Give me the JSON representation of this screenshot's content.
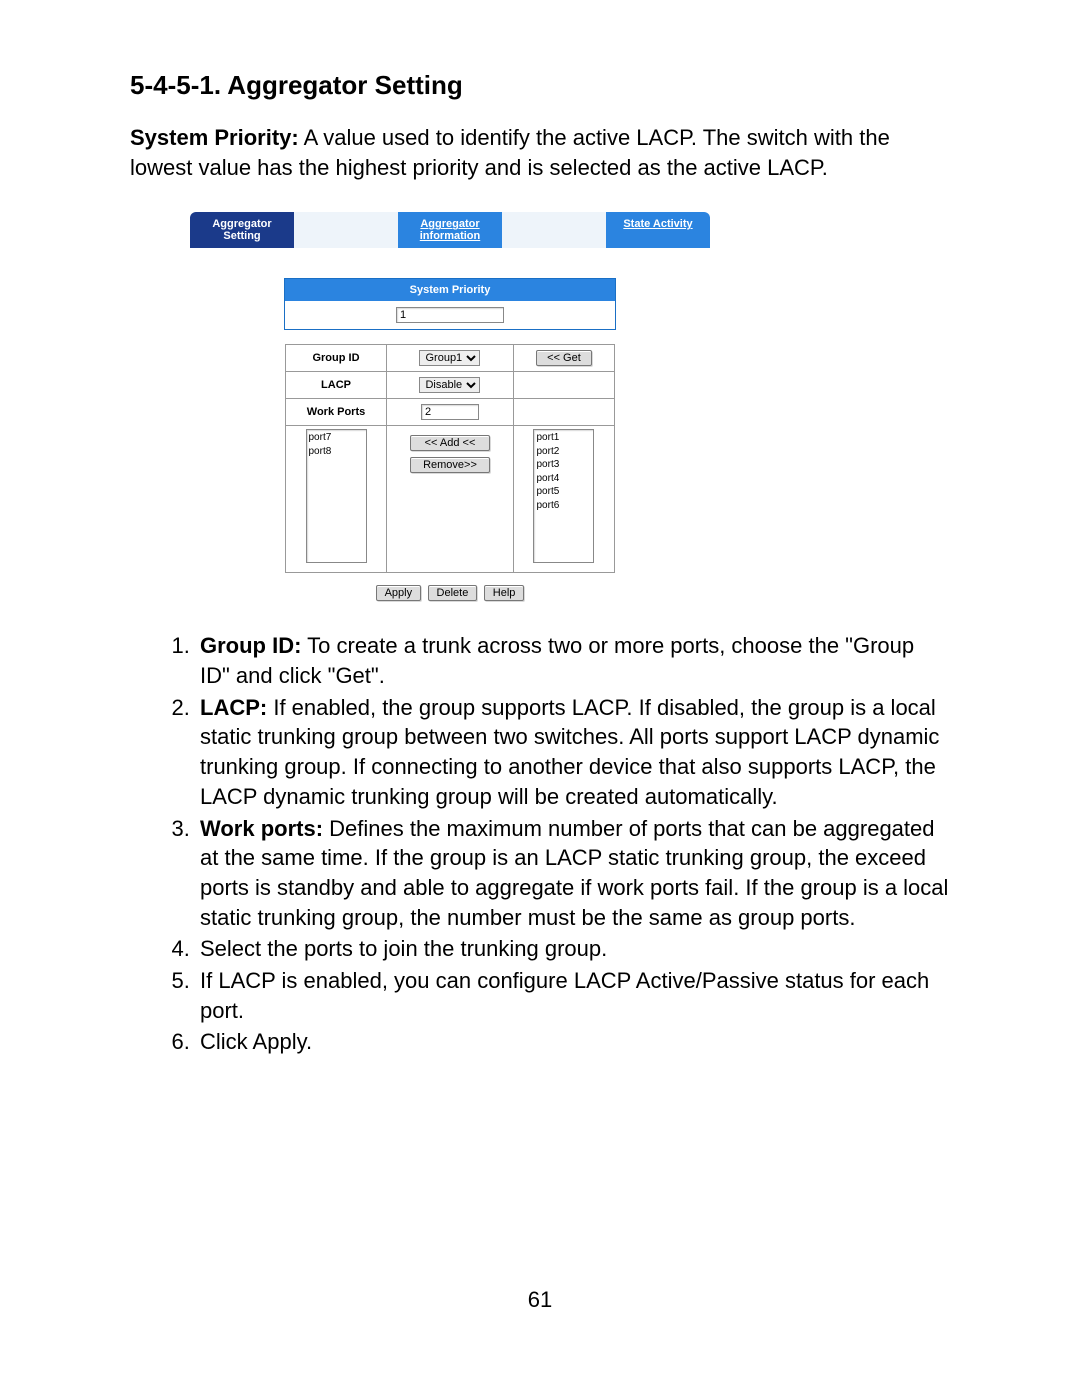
{
  "heading": "5-4-5-1. Aggregator Setting",
  "intro_label": "System Priority:",
  "intro_text": " A value used to identify the active LACP. The switch with the lowest value has the highest priority and is selected as the active LACP.",
  "tabs": {
    "t0": "Aggregator Setting",
    "t1": "Aggregator information",
    "t2": "State Activity"
  },
  "panel": {
    "sys_priority_label": "System Priority",
    "sys_priority_value": "1",
    "row_group_label": "Group ID",
    "row_group_value": "Group1",
    "row_group_btn": "<< Get",
    "row_lacp_label": "LACP",
    "row_lacp_value": "Disable",
    "row_wp_label": "Work Ports",
    "row_wp_value": "2",
    "left_ports": [
      "port7",
      "port8"
    ],
    "right_ports": [
      "port1",
      "port2",
      "port3",
      "port4",
      "port5",
      "port6"
    ],
    "btn_add": "<< Add <<",
    "btn_remove": "Remove>>",
    "btn_apply": "Apply",
    "btn_delete": "Delete",
    "btn_help": "Help"
  },
  "list": {
    "i1_label": "Group ID:",
    "i1_text": " To create a trunk across two or more ports, choose the \"Group ID\" and click \"Get\".",
    "i2_label": "LACP:",
    "i2_text": " If enabled, the group supports LACP. If disabled, the group is a local static trunking group between two switches.  All ports support LACP dynamic trunking group. If connecting to another device that also supports LACP, the LACP dynamic trunking group will be created automatically.",
    "i3_label": "Work ports:",
    "i3_text": " Defines the maximum number of ports that can be aggregated at the same time. If the group is an LACP static trunking group, the exceed ports is standby and able to aggregate if work ports fail. If the group is a local static trunking group, the number must be the same as group ports.",
    "i4_text": "Select the ports to join the trunking group.",
    "i5_text": "If LACP is enabled, you can configure LACP Active/Passive status for each port.",
    "i6_text": "Click Apply."
  },
  "page_number": "61"
}
